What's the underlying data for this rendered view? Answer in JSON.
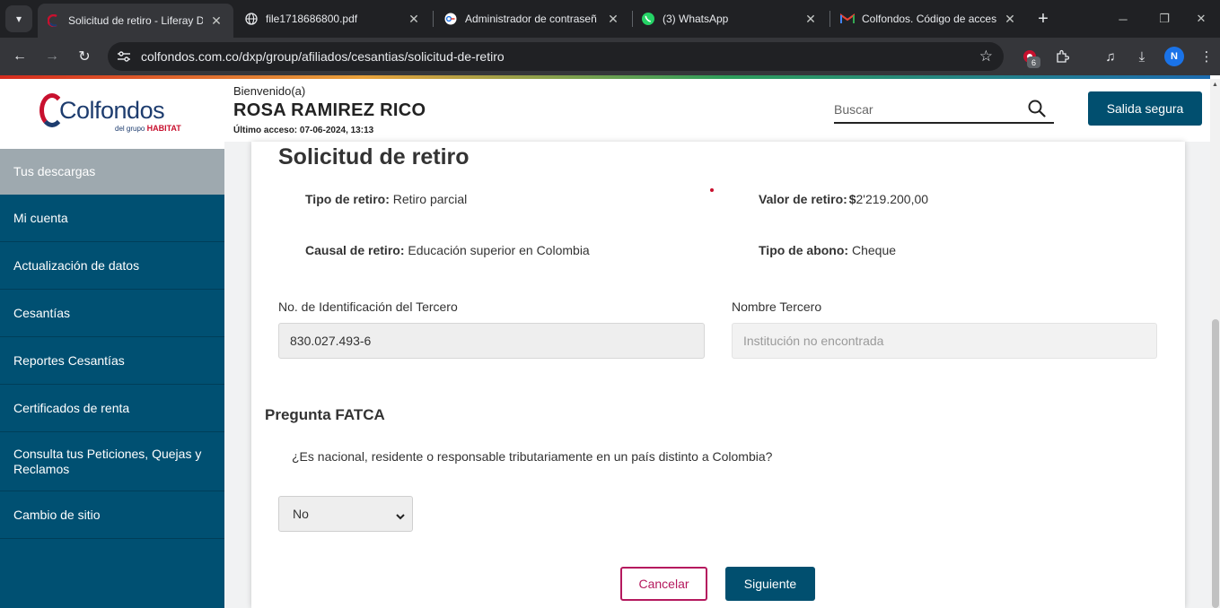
{
  "browser": {
    "tabs": [
      {
        "title": "Solicitud de retiro - Liferay D",
        "favicon": "colfondos-icon",
        "active": true
      },
      {
        "title": "file1718686800.pdf",
        "favicon": "globe-icon",
        "active": false
      },
      {
        "title": "Administrador de contraseñ",
        "favicon": "password-manager-icon",
        "active": false
      },
      {
        "title": "(3) WhatsApp",
        "favicon": "whatsapp-icon",
        "active": false
      },
      {
        "title": "Colfondos. Código de acceso",
        "favicon": "gmail-icon",
        "active": false
      }
    ],
    "url": "colfondos.com.co/dxp/group/afiliados/cesantias/solicitud-de-retiro",
    "extension_badge": "6",
    "profile_initial": "N"
  },
  "header": {
    "logo_text": "Colfondos",
    "logo_sub": "del grupo",
    "logo_sub_brand": "HABITAT",
    "welcome": "Bienvenido(a)",
    "user_name": "ROSA RAMIREZ RICO",
    "last_access": "Último acceso: 07-06-2024, 13:13",
    "search_placeholder": "Buscar",
    "safe_exit": "Salida segura"
  },
  "sidebar": {
    "items": [
      {
        "label": "Tus descargas",
        "active": true
      },
      {
        "label": "Mi cuenta"
      },
      {
        "label": "Actualización de datos"
      },
      {
        "label": "Cesantías"
      },
      {
        "label": "Reportes Cesantías"
      },
      {
        "label": "Certificados de renta"
      },
      {
        "label": "Consulta tus Peticiones, Quejas y Reclamos"
      },
      {
        "label": "Cambio de sitio"
      }
    ]
  },
  "main": {
    "title": "Solicitud de retiro",
    "tipo_retiro_label": "Tipo de retiro:",
    "tipo_retiro_value": "Retiro parcial",
    "valor_retiro_label": "Valor de retiro:",
    "valor_retiro_currency": "$",
    "valor_retiro_value": "2'219.200,00",
    "causal_label": "Causal de retiro:",
    "causal_value": "Educación superior en Colombia",
    "tipo_abono_label": "Tipo de abono:",
    "tipo_abono_value": "Cheque",
    "id_tercero_label": "No. de Identificación del Tercero",
    "id_tercero_value": "830.027.493-6",
    "nombre_tercero_label": "Nombre Tercero",
    "nombre_tercero_value": "Institución no encontrada",
    "fatca_title": "Pregunta FATCA",
    "fatca_question": "¿Es nacional, residente o responsable tributariamente en un país distinto a Colombia?",
    "fatca_answer": "No",
    "cancel_label": "Cancelar",
    "next_label": "Siguiente"
  },
  "colors": {
    "primary": "#014f6f",
    "sidebar": "#005072",
    "sidebar_active": "#9ea9af",
    "cancel_border": "#b5195e",
    "brand_red": "#c8102e",
    "brand_blue": "#1d3c6e"
  }
}
